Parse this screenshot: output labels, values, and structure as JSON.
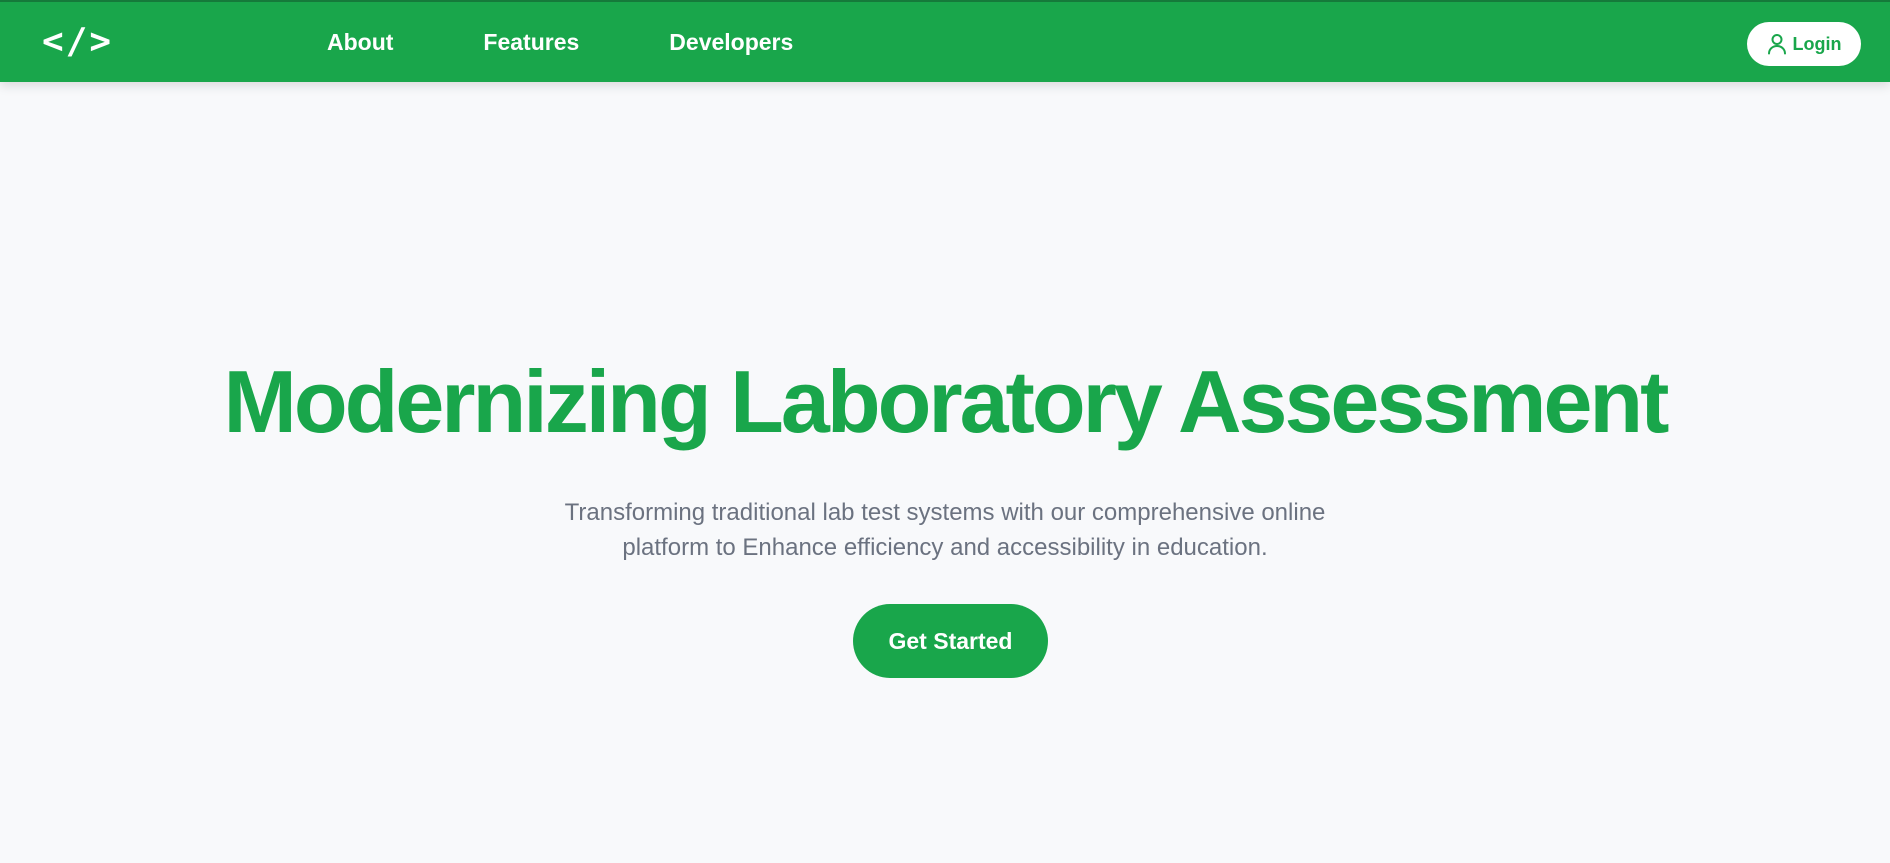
{
  "brand": {
    "logo_text": "</>",
    "accent_color": "#19a64b"
  },
  "nav": {
    "links": [
      {
        "label": "About"
      },
      {
        "label": "Features"
      },
      {
        "label": "Developers"
      }
    ],
    "login_label": "Login",
    "login_icon": "user-icon"
  },
  "hero": {
    "title": "Modernizing Laboratory Assessment",
    "subtitle": "Transforming traditional lab test systems with our comprehensive online platform to Enhance efficiency and accessibility in education.",
    "cta_label": "Get Started"
  }
}
